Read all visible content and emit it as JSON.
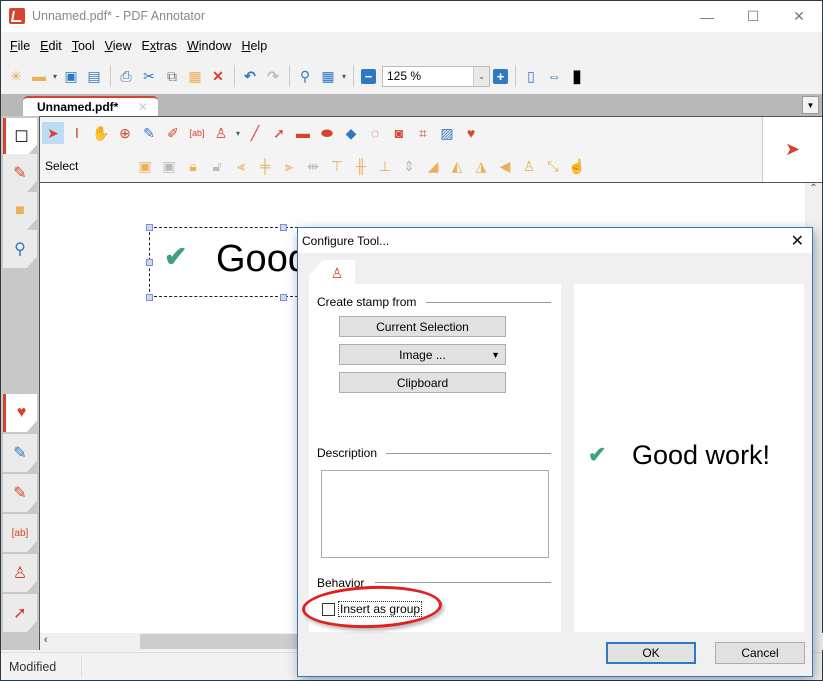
{
  "window": {
    "title": "Unnamed.pdf* - PDF Annotator",
    "controls": {
      "minimize": "—",
      "maximize": "☐",
      "close": "✕"
    }
  },
  "menu": [
    {
      "label": "File",
      "accel": "F",
      "rest": "ile"
    },
    {
      "label": "Edit",
      "accel": "E",
      "rest": "dit"
    },
    {
      "label": "Tool",
      "accel": "T",
      "rest": "ool"
    },
    {
      "label": "View",
      "accel": "V",
      "rest": "iew"
    },
    {
      "label": "Extras",
      "accel": "x",
      "pre": "E",
      "rest": "tras"
    },
    {
      "label": "Window",
      "accel": "W",
      "rest": "indow"
    },
    {
      "label": "Help",
      "accel": "H",
      "rest": "elp"
    }
  ],
  "toolbar": {
    "zoom_value": "125 %",
    "icons": [
      "new-document",
      "open-folder",
      "save",
      "save-as",
      "print",
      "cut",
      "copy",
      "paste",
      "delete",
      "undo",
      "redo",
      "find",
      "grid",
      "zoom-out",
      "zoom-in",
      "fit-page",
      "fit-width",
      "full-screen"
    ]
  },
  "tabs": {
    "document_tab": "Unnamed.pdf*",
    "close": "✕",
    "menu_arrow": "▼"
  },
  "tools": {
    "mode_label": "Select",
    "row1": [
      "select",
      "text-select",
      "hand",
      "zoom",
      "pen",
      "highlighter",
      "text-box",
      "stamp",
      "line",
      "arrow",
      "rectangle",
      "ellipse",
      "eraser",
      "lasso",
      "snapshot",
      "crop",
      "insert-image",
      "favorites"
    ],
    "row2": [
      "group",
      "ungroup",
      "lock",
      "unlock",
      "align-left",
      "align-center",
      "align-right",
      "distribute-h",
      "align-top",
      "align-middle",
      "align-bottom",
      "distribute-v",
      "rotate",
      "rotate-right",
      "flip-h",
      "flip-v",
      "add-stamp",
      "resize",
      "touch"
    ]
  },
  "document": {
    "stamp_text": "Good work!",
    "stamp_visible_text": "Good"
  },
  "status": {
    "text": "Modified"
  },
  "dialog": {
    "title": "Configure Tool...",
    "close": "✕",
    "sections": {
      "create_from": "Create stamp from",
      "description": "Description",
      "behavior": "Behavior"
    },
    "buttons": {
      "current_selection": "Current Selection",
      "image": "Image ...",
      "clipboard": "Clipboard",
      "ok": "OK",
      "cancel": "Cancel"
    },
    "description_value": "",
    "insert_as_group": {
      "label": "Insert as group",
      "checked": false
    },
    "preview_text": "Good work!"
  },
  "colors": {
    "accent": "#d7442e",
    "check_green": "#3ea27b",
    "dialog_border": "#2f79c3",
    "highlight": "#e02020"
  }
}
